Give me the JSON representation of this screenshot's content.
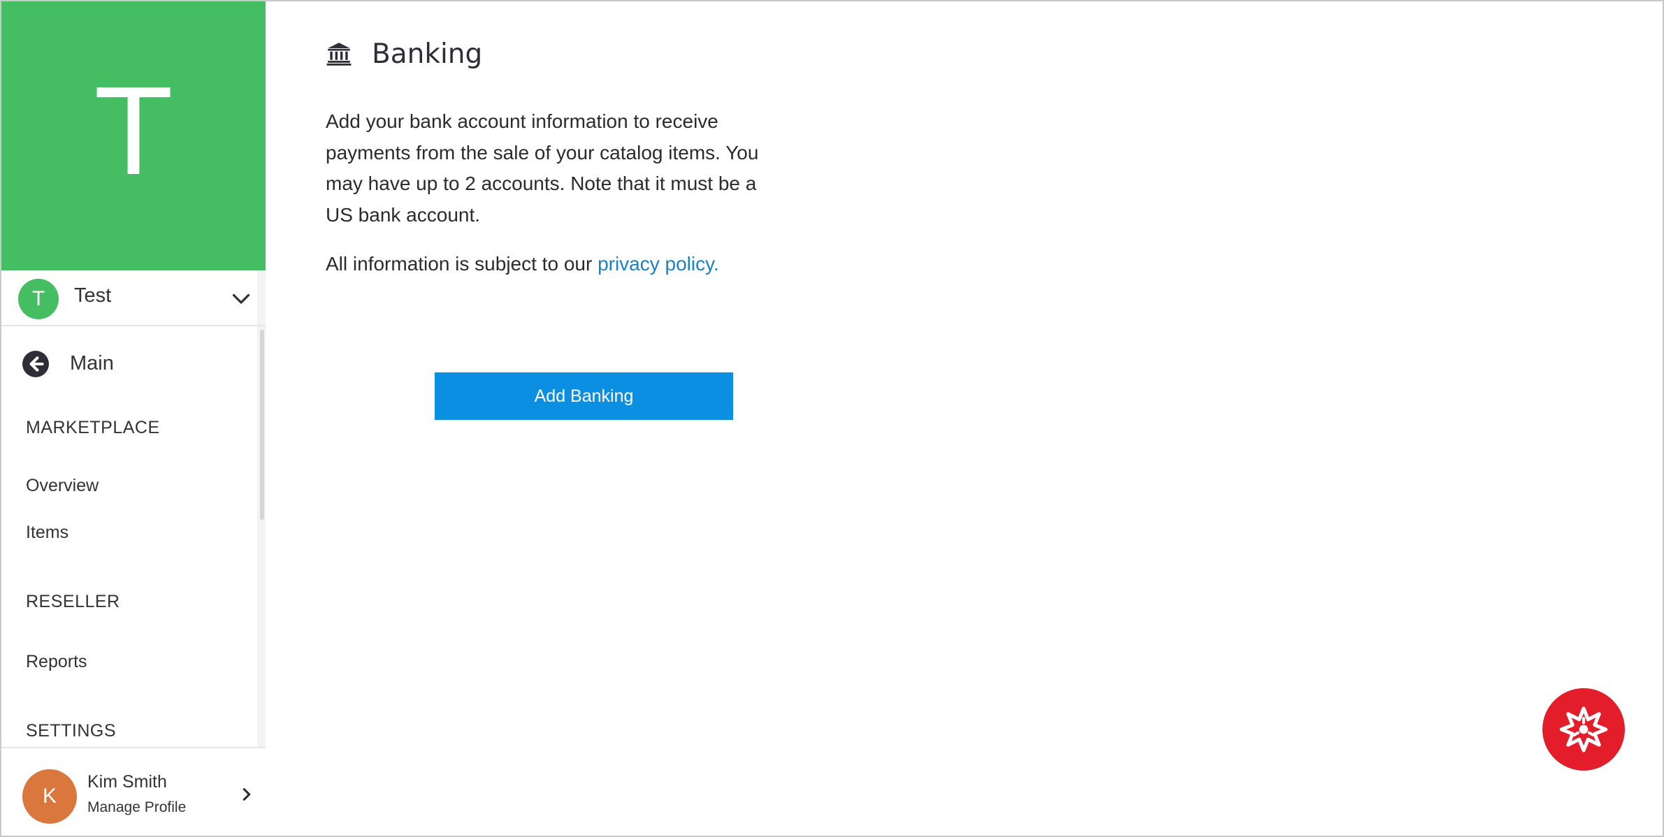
{
  "sidebar": {
    "hero_letter": "T",
    "org": {
      "avatar_letter": "T",
      "name": "Test",
      "avatar_color": "#44bd63"
    },
    "main_link": "Main",
    "sections": {
      "marketplace": {
        "heading": "MARKETPLACE",
        "items": [
          "Overview",
          "Items"
        ]
      },
      "reseller": {
        "heading": "RESELLER",
        "items": [
          "Reports"
        ]
      },
      "settings": {
        "heading": "SETTINGS"
      }
    },
    "profile": {
      "avatar_letter": "K",
      "name": "Kim Smith",
      "subtitle": "Manage Profile",
      "avatar_color": "#d9773d"
    }
  },
  "main": {
    "title": "Banking",
    "description": "Add your bank account information to receive payments from the sale of your catalog items. You may have up to 2 accounts. Note that it must be a US bank account.",
    "policy_prefix": "All information is subject to our ",
    "policy_link": "privacy policy.",
    "add_button": "Add Banking"
  },
  "colors": {
    "brand_green": "#44bd63",
    "button_blue": "#0b8fe3",
    "link_blue": "#1a82c4",
    "help_red": "#e31e2a"
  },
  "icons": {
    "title": "bank-icon",
    "org_toggle": "chevron-down-icon",
    "main_link": "arrow-left-circle-icon",
    "profile": "chevron-right-icon",
    "help": "help-badge-icon"
  }
}
